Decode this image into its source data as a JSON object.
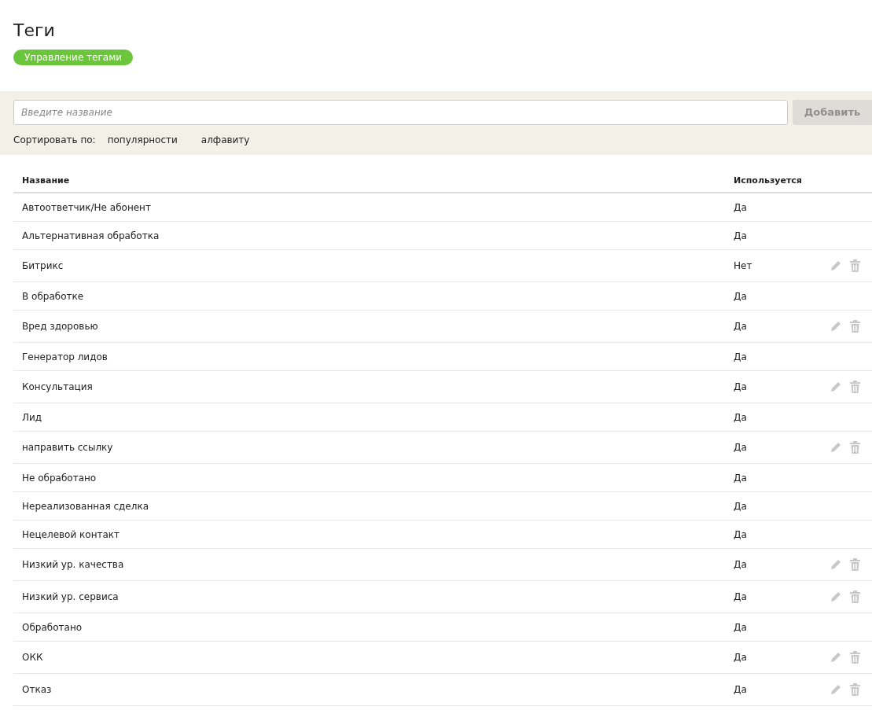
{
  "title": "Теги",
  "manage_button": {
    "label": "Управление тегами"
  },
  "search": {
    "placeholder": "Введите название"
  },
  "add_button": {
    "label": "Добавить",
    "disabled": true
  },
  "sort": {
    "label": "Сортировать по:",
    "options": [
      {
        "label": "популярности"
      },
      {
        "label": "алфавиту"
      }
    ]
  },
  "table": {
    "columns": [
      "Название",
      "Используется"
    ],
    "rows": [
      {
        "name": "Автоответчик/Не абонент",
        "used": "Да",
        "editable": false
      },
      {
        "name": "Альтернативная обработка",
        "used": "Да",
        "editable": false
      },
      {
        "name": "Битрикс",
        "used": "Нет",
        "editable": true
      },
      {
        "name": "В обработке",
        "used": "Да",
        "editable": false
      },
      {
        "name": "Вред здоровью",
        "used": "Да",
        "editable": true
      },
      {
        "name": "Генератор лидов",
        "used": "Да",
        "editable": false
      },
      {
        "name": "Консультация",
        "used": "Да",
        "editable": true
      },
      {
        "name": "Лид",
        "used": "Да",
        "editable": false
      },
      {
        "name": "направить ссылку",
        "used": "Да",
        "editable": true
      },
      {
        "name": "Не обработано",
        "used": "Да",
        "editable": false
      },
      {
        "name": "Нереализованная сделка",
        "used": "Да",
        "editable": false
      },
      {
        "name": "Нецелевой контакт",
        "used": "Да",
        "editable": false
      },
      {
        "name": "Низкий ур. качества",
        "used": "Да",
        "editable": true
      },
      {
        "name": "Низкий ур. сервиса",
        "used": "Да",
        "editable": true
      },
      {
        "name": "Обработано",
        "used": "Да",
        "editable": false
      },
      {
        "name": "ОКК",
        "used": "Да",
        "editable": true
      },
      {
        "name": "Отказ",
        "used": "Да",
        "editable": true
      }
    ]
  }
}
